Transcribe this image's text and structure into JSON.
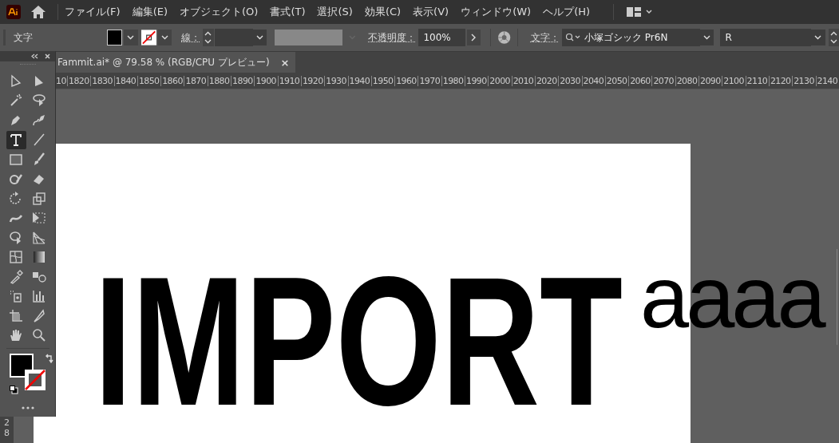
{
  "menu_bar": {
    "items": [
      "ファイル(F)",
      "編集(E)",
      "オブジェクト(O)",
      "書式(T)",
      "選択(S)",
      "効果(C)",
      "表示(V)",
      "ウィンドウ(W)",
      "ヘルプ(H)"
    ]
  },
  "control_bar": {
    "mode_label": "文字",
    "stroke_label": "線：",
    "opacity_label": "不透明度：",
    "opacity_value": "100%",
    "font_label": "文字：",
    "font_family": "小塚ゴシック Pr6N",
    "font_style": "R"
  },
  "document_tab": {
    "title": "Fammit.ai* @ 79.58 % (RGB/CPU プレビュー)",
    "close": "×"
  },
  "ruler": {
    "labels": [
      "10",
      "1820",
      "1830",
      "1840",
      "1850",
      "1860",
      "1870",
      "1880",
      "1890",
      "1900",
      "1910",
      "1920",
      "1930",
      "1940",
      "1950",
      "1960",
      "1970",
      "1980",
      "1990",
      "2000",
      "2010",
      "2020",
      "2030",
      "2040",
      "2050",
      "2060",
      "2070",
      "2080",
      "2090",
      "2100",
      "2110",
      "2120",
      "2130",
      "2140"
    ],
    "vertical_labels": [
      "2",
      "8"
    ]
  },
  "tools": [
    {
      "kind": "direct-select",
      "selected": false
    },
    {
      "kind": "select",
      "selected": false
    },
    {
      "kind": "wand",
      "selected": false
    },
    {
      "kind": "lasso",
      "selected": false
    },
    {
      "kind": "pen",
      "selected": false
    },
    {
      "kind": "curvature",
      "selected": false
    },
    {
      "kind": "type",
      "selected": true
    },
    {
      "kind": "line",
      "selected": false
    },
    {
      "kind": "rectangle",
      "selected": false
    },
    {
      "kind": "brush",
      "selected": false
    },
    {
      "kind": "shaper",
      "selected": false
    },
    {
      "kind": "eraser",
      "selected": false
    },
    {
      "kind": "rotate",
      "selected": false
    },
    {
      "kind": "scale",
      "selected": false
    },
    {
      "kind": "warp",
      "selected": false
    },
    {
      "kind": "free-transform",
      "selected": false
    },
    {
      "kind": "shape-builder",
      "selected": false
    },
    {
      "kind": "perspective",
      "selected": false
    },
    {
      "kind": "mesh",
      "selected": false
    },
    {
      "kind": "gradient",
      "selected": false
    },
    {
      "kind": "eyedropper",
      "selected": false
    },
    {
      "kind": "blend",
      "selected": false
    },
    {
      "kind": "sprayer",
      "selected": false
    },
    {
      "kind": "graph",
      "selected": false
    },
    {
      "kind": "artboard",
      "selected": false
    },
    {
      "kind": "knife",
      "selected": false
    },
    {
      "kind": "hand",
      "selected": false
    },
    {
      "kind": "zoom",
      "selected": false
    }
  ],
  "artwork": {
    "headline": "IMPORT",
    "body_text": "aaaa"
  }
}
